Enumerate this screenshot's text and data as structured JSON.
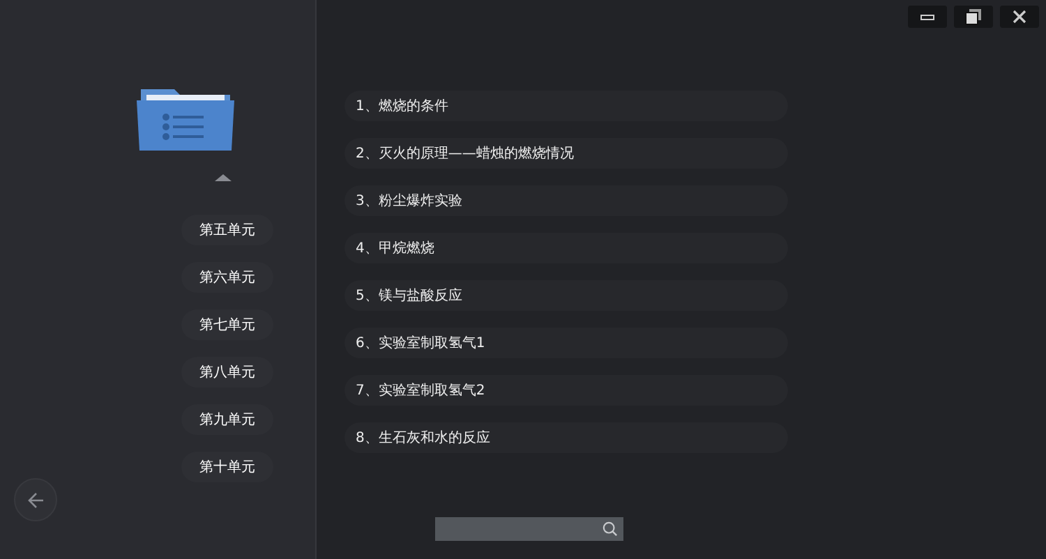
{
  "units": [
    {
      "label": "第五单元"
    },
    {
      "label": "第六单元"
    },
    {
      "label": "第七单元"
    },
    {
      "label": "第八单元"
    },
    {
      "label": "第九单元"
    },
    {
      "label": "第十单元"
    }
  ],
  "experiments": [
    {
      "label": "1、燃烧的条件"
    },
    {
      "label": "2、灭火的原理——蜡烛的燃烧情况"
    },
    {
      "label": "3、粉尘爆炸实验"
    },
    {
      "label": "4、甲烷燃烧"
    },
    {
      "label": "5、镁与盐酸反应"
    },
    {
      "label": "6、实验室制取氢气1"
    },
    {
      "label": "7、实验室制取氢气2"
    },
    {
      "label": "8、生石灰和水的反应"
    }
  ]
}
